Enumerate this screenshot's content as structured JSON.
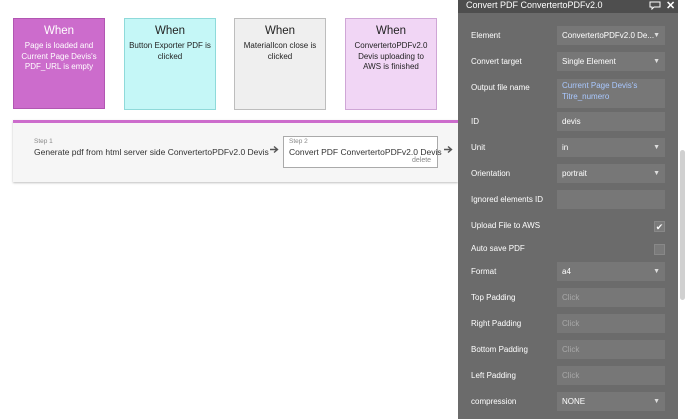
{
  "events": [
    {
      "when": "When",
      "desc": "Page is loaded and Current Page Devis's PDF_URL is empty"
    },
    {
      "when": "When",
      "desc": "Button Exporter PDF is clicked"
    },
    {
      "when": "When",
      "desc": "MaterialIcon close is clicked"
    },
    {
      "when": "When",
      "desc": "ConvertertoPDFv2.0 Devis uploading to AWS is finished"
    }
  ],
  "steps": [
    {
      "num": "Step 1",
      "title": "Generate pdf from html server side ConvertertoPDFv2.0 Devis"
    },
    {
      "num": "Step 2",
      "title": "Convert PDF ConvertertoPDFv2.0 Devis",
      "delete": "delete"
    }
  ],
  "panel": {
    "title": "Convert PDF ConvertertoPDFv2.0",
    "rows": [
      {
        "label": "Element",
        "value": "ConvertertoPDFv2.0 De...",
        "kind": "select"
      },
      {
        "label": "Convert target",
        "value": "Single Element",
        "kind": "select"
      },
      {
        "label": "Output file name",
        "value": "Current Page Devis's Titre_numero",
        "kind": "dynamic"
      },
      {
        "label": "ID",
        "value": "devis",
        "kind": "text"
      },
      {
        "label": "Unit",
        "value": "in",
        "kind": "select"
      },
      {
        "label": "Orientation",
        "value": "portrait",
        "kind": "select"
      },
      {
        "label": "Ignored elements ID",
        "value": "",
        "kind": "text"
      },
      {
        "label": "Upload File to AWS",
        "value": "✔",
        "kind": "checkbox",
        "checked": true
      },
      {
        "label": "Auto save PDF",
        "value": "",
        "kind": "checkbox",
        "checked": false
      },
      {
        "label": "Format",
        "value": "a4",
        "kind": "select"
      },
      {
        "label": "Top Padding",
        "value": "Click",
        "kind": "placeholder"
      },
      {
        "label": "Right Padding",
        "value": "Click",
        "kind": "placeholder"
      },
      {
        "label": "Bottom Padding",
        "value": "Click",
        "kind": "placeholder"
      },
      {
        "label": "Left Padding",
        "value": "Click",
        "kind": "placeholder"
      },
      {
        "label": "compression",
        "value": "NONE",
        "kind": "select"
      }
    ]
  },
  "icons": {
    "comment": "comment-icon",
    "close": "close-icon",
    "arrow": "arrow-right-icon",
    "caret": "caret-down-icon",
    "check": "checkmark-icon"
  },
  "colors": {
    "event_primary": "#cc6ccc",
    "event_button": "#c5f7f7",
    "event_icon": "#efefef",
    "event_aws": "#f1d6f5",
    "panel_bg": "#6b6b6b",
    "dynamic_text": "#a9c8ff"
  }
}
